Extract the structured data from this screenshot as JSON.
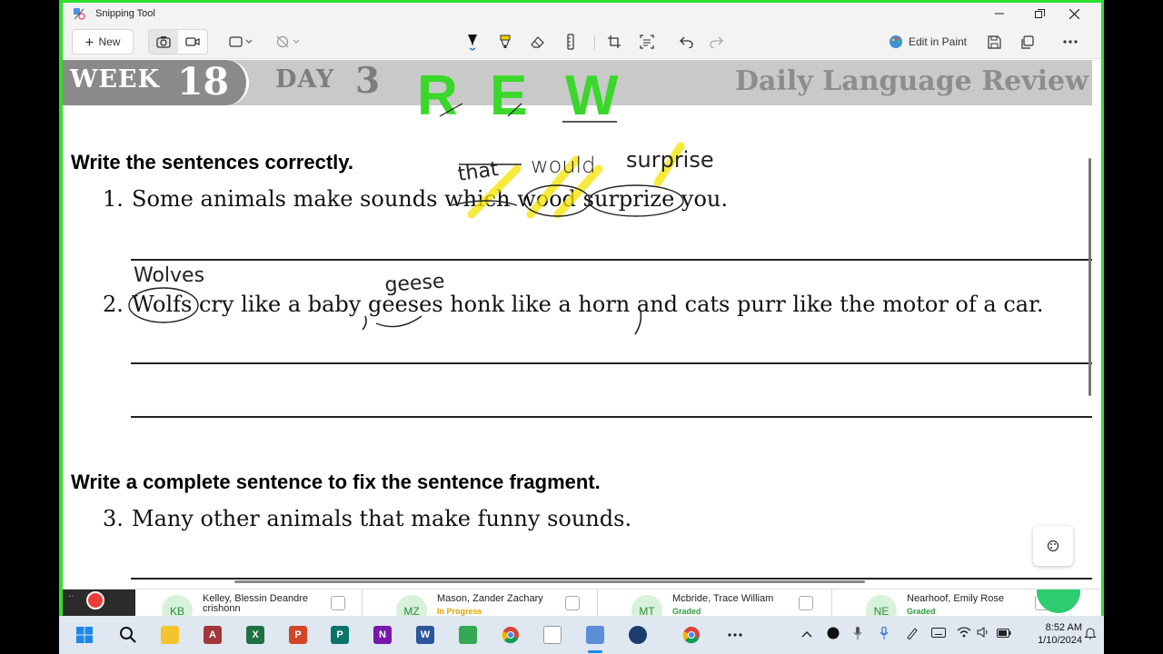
{
  "window": {
    "title": "Snipping Tool",
    "new_label": "New",
    "edit_in_paint_label": "Edit in Paint"
  },
  "worksheet": {
    "week_label": "WEEK",
    "week_number": "18",
    "day_label": "DAY",
    "day_number": "3",
    "series_title": "Daily Language Review",
    "heading1": "Write the sentences correctly.",
    "sentences": [
      {
        "number": "1.",
        "text": "Some animals make sounds which wood surprize you."
      },
      {
        "number": "2.",
        "text": "Wolfs cry like a baby geeses honk like a horn and cats purr like the motor of a car."
      },
      {
        "number": "3.",
        "text": "Many other animals that make funny sounds."
      }
    ],
    "heading2": "Write a complete sentence to fix the sentence fragment."
  },
  "annotations": {
    "top_letters": [
      "R",
      "E",
      "W"
    ],
    "sentence1_that": "that",
    "sentence1_would": "would",
    "sentence1_surprise": "surprise",
    "sentence2_wolves": "Wolves",
    "sentence2_geese": "geese"
  },
  "students": [
    {
      "initials": "KB",
      "name": "Kelley, Blessin Deandre crishonn",
      "status": "",
      "status_color": "#2e9a3e"
    },
    {
      "initials": "MZ",
      "name": "Mason, Zander Zachary",
      "status": "In Progress",
      "status_color": "#e0a400"
    },
    {
      "initials": "MT",
      "name": "Mcbride, Trace William",
      "status": "Graded",
      "status_color": "#2e9a3e"
    },
    {
      "initials": "NE",
      "name": "Nearhoof, Emily Rose",
      "status": "Graded",
      "status_color": "#2e9a3e"
    }
  ],
  "clock": {
    "time": "8:52 AM",
    "date": "1/10/2024"
  },
  "colors": {
    "frame_green": "#2ee02e",
    "annotation_green": "#3ad82a",
    "highlight_yellow": "#f5e400",
    "avatar_bg": "#d8f1d9"
  }
}
